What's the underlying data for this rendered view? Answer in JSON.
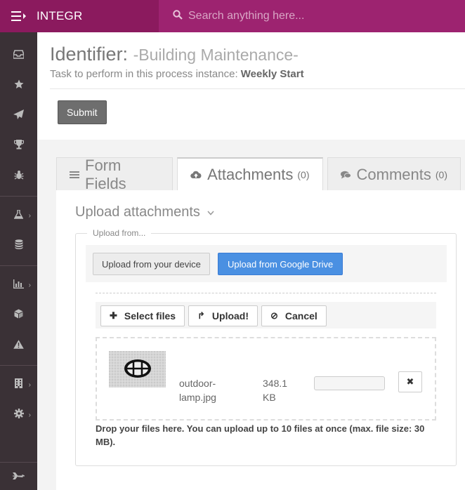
{
  "app": {
    "brand": "INTEGR",
    "search_placeholder": "Search anything here..."
  },
  "sidebar": {
    "items": [
      {
        "icon": "inbox-icon"
      },
      {
        "icon": "star-icon"
      },
      {
        "icon": "paper-plane-icon"
      },
      {
        "icon": "trophy-icon"
      },
      {
        "icon": "bug-icon"
      },
      {
        "icon": "flask-icon",
        "submenu": true
      },
      {
        "icon": "database-icon"
      },
      {
        "icon": "bar-chart-icon",
        "submenu": true
      },
      {
        "icon": "cube-icon"
      },
      {
        "icon": "warning-icon"
      },
      {
        "icon": "building-icon",
        "submenu": true
      },
      {
        "icon": "gear-icon",
        "submenu": true
      }
    ],
    "bottom_icon": "plane-icon"
  },
  "header": {
    "identifier_label": "Identifier:",
    "process_name": "-Building Maintenance-",
    "task_prefix": "Task to perform in this process instance:",
    "task_name": "Weekly Start"
  },
  "actions": {
    "submit_label": "Submit"
  },
  "tabs": [
    {
      "label": "Form Fields",
      "count": "",
      "icon": "list-icon"
    },
    {
      "label": "Attachments",
      "count": "(0)",
      "icon": "cloud-upload-icon",
      "active": true
    },
    {
      "label": "Comments",
      "count": "(0)",
      "icon": "comments-icon"
    }
  ],
  "upload": {
    "title": "Upload attachments",
    "legend": "Upload from...",
    "from_device": "Upload from your device",
    "from_gdrive": "Upload from Google Drive",
    "select_files": "Select files",
    "upload_btn": "Upload!",
    "cancel_btn": "Cancel",
    "file": {
      "name": "outdoor-lamp.jpg",
      "size": "348.1 KB",
      "progress": 0
    },
    "drop_note": "Drop your files here. You can upload up to 10 files at once (max. file size: 30 MB)."
  },
  "colors": {
    "brand": "#8b1a5e",
    "search_bg": "#9d2370",
    "sidebar_bg": "#3a3136",
    "primary_button": "#4a90e2"
  }
}
